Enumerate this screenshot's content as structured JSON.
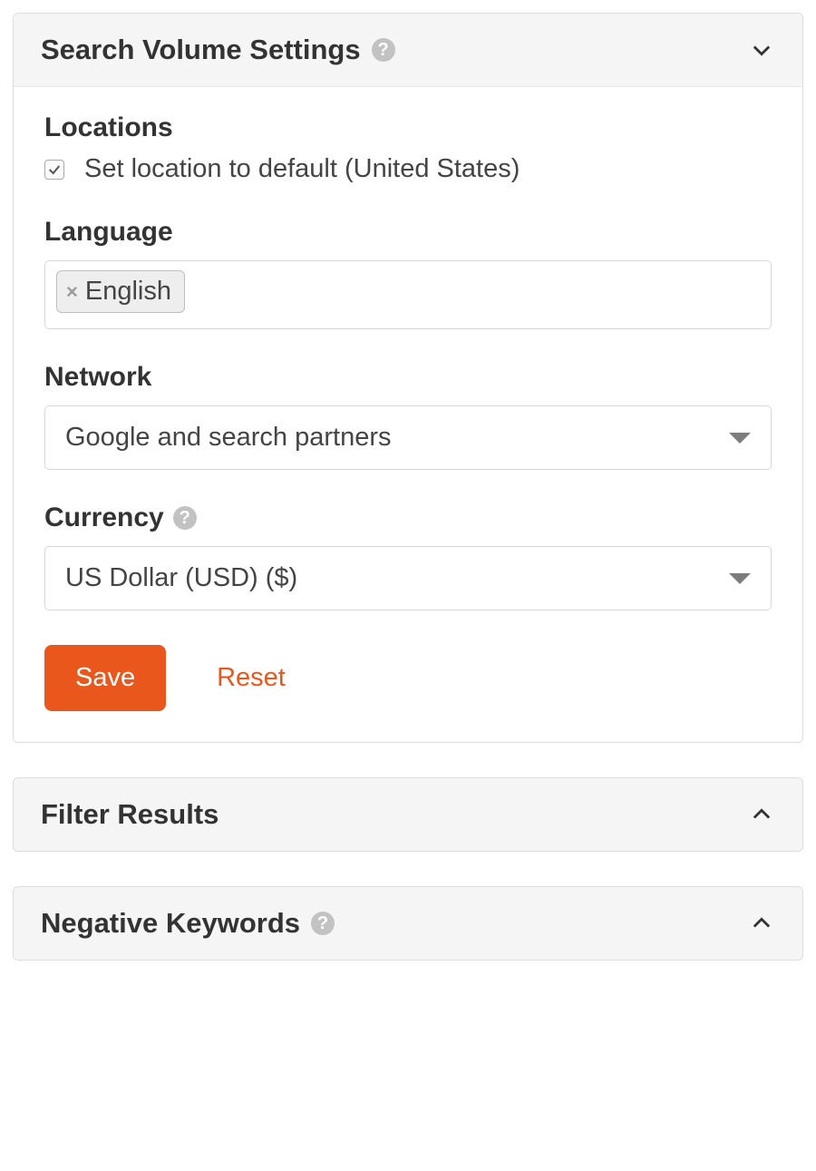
{
  "panels": {
    "search_volume": {
      "title": "Search Volume Settings",
      "expanded": true
    },
    "filter_results": {
      "title": "Filter Results",
      "expanded": false
    },
    "negative_keywords": {
      "title": "Negative Keywords",
      "expanded": false
    }
  },
  "settings": {
    "locations": {
      "label": "Locations",
      "default_checkbox_label": "Set location to default (United States)",
      "default_checked": true
    },
    "language": {
      "label": "Language",
      "tags": [
        "English"
      ]
    },
    "network": {
      "label": "Network",
      "value": "Google and search partners"
    },
    "currency": {
      "label": "Currency",
      "value": "US Dollar (USD) ($)"
    }
  },
  "buttons": {
    "save": "Save",
    "reset": "Reset"
  }
}
